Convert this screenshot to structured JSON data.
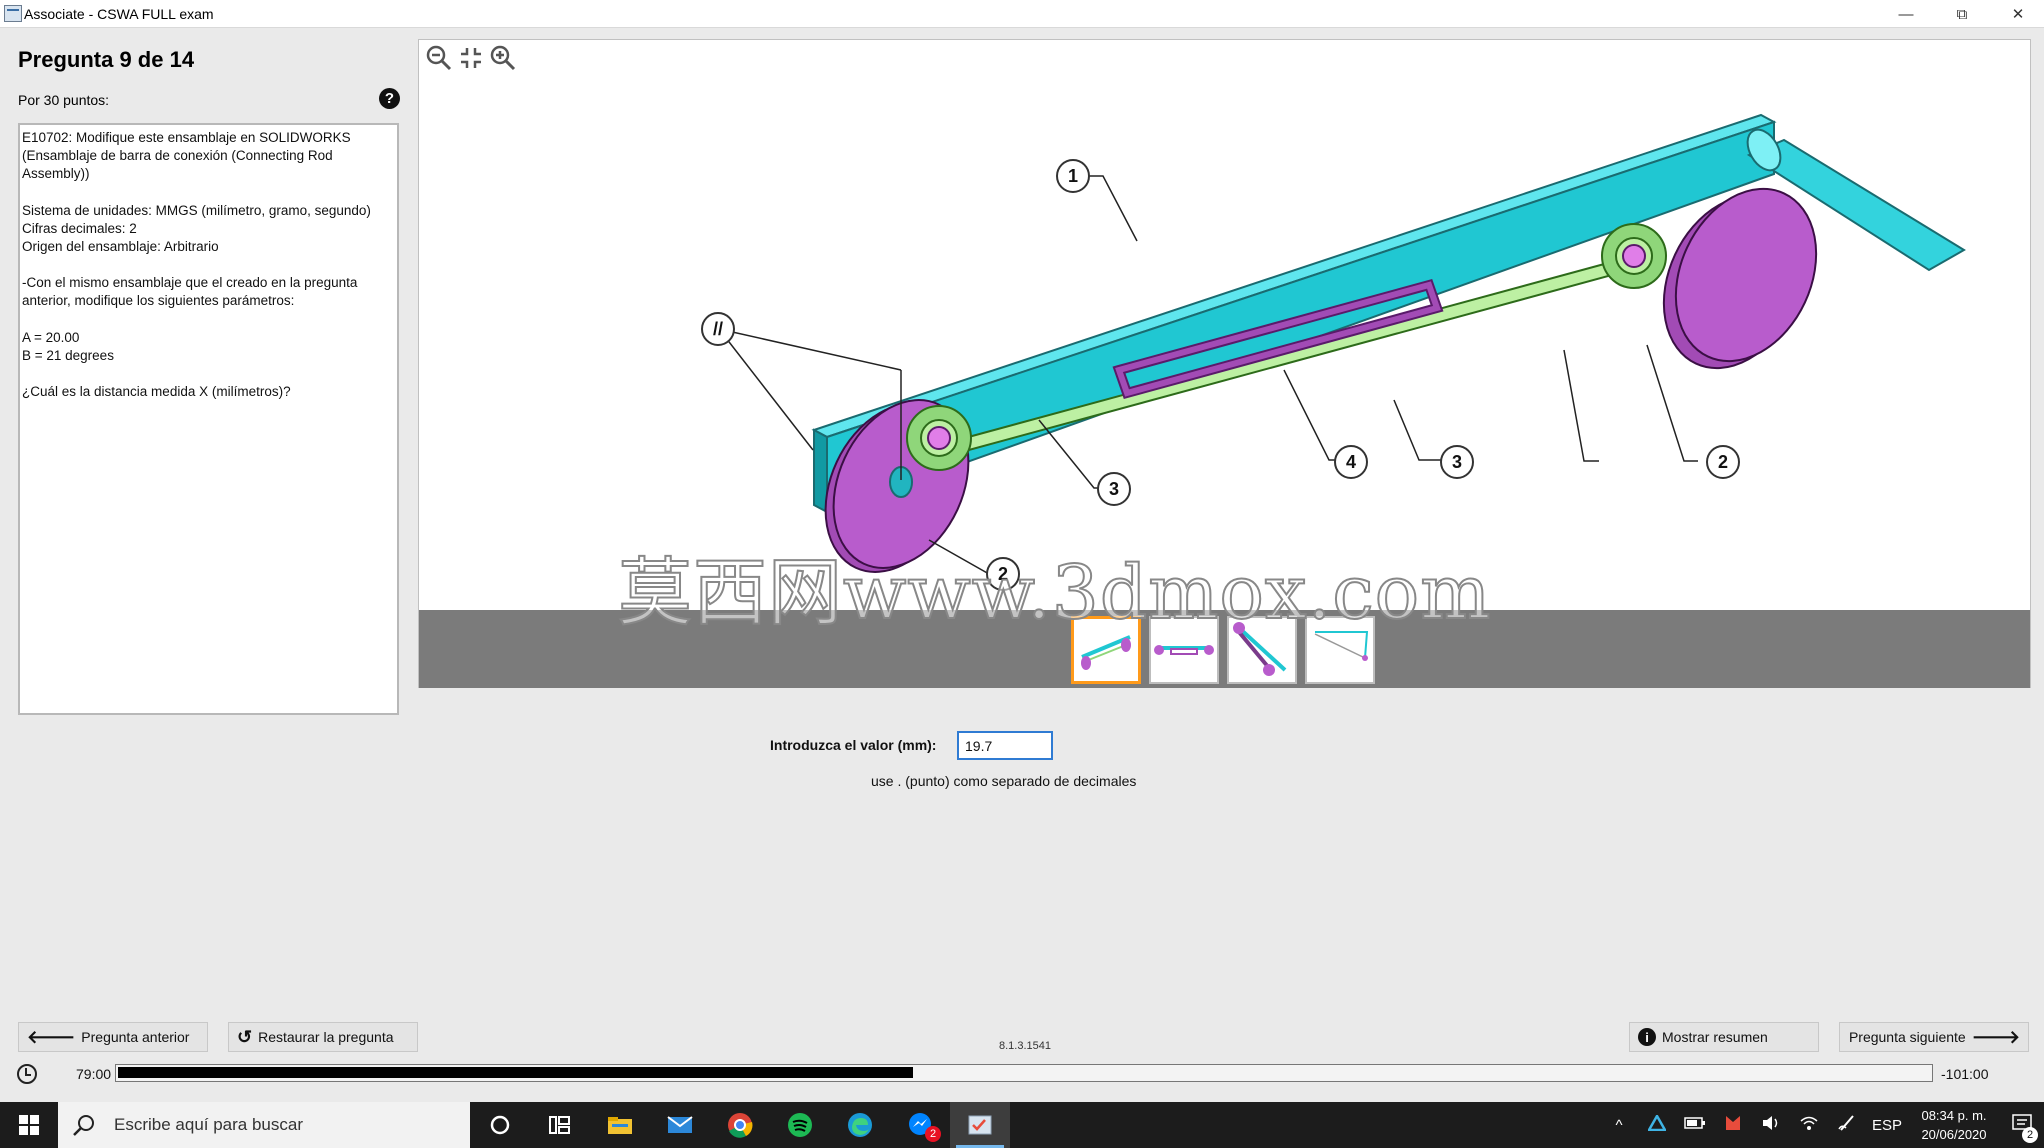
{
  "window": {
    "title": "Associate - CSWA FULL exam",
    "minimize": "—",
    "restore": "⧉",
    "close": "✕"
  },
  "question": {
    "header": "Pregunta 9 de 14",
    "points": "Por 30 puntos:",
    "help_icon": "?",
    "text_lines": [
      "E10702:  Modifique este ensamblaje en SOLIDWORKS",
      "(Ensamblaje de barra de conexión (Connecting Rod",
      "Assembly))",
      "",
      "Sistema de unidades: MMGS (milímetro, gramo, segundo)",
      "Cifras decimales: 2",
      "Origen del ensamblaje: Arbitrario",
      "",
      "-Con el mismo ensamblaje que el creado en la pregunta",
      "anterior, modifique los siguientes parámetros:",
      "",
      "A = 20.00",
      "B = 21 degrees",
      "",
      "¿Cuál es la distancia medida X (milímetros)?"
    ]
  },
  "viewer": {
    "tools": [
      "zoom-out-icon",
      "fit-icon",
      "zoom-in-icon"
    ],
    "callouts": {
      "c1": "1",
      "c2a": "2",
      "c2b": "2",
      "c3a": "3",
      "c3b": "3",
      "c4": "4",
      "parallel": "//"
    },
    "watermark": "莫西网www.3dmox.com",
    "thumbnails_count": 4,
    "active_thumbnail": 0
  },
  "answer": {
    "label": "Introduzca el valor (mm):",
    "value": "19.7",
    "hint": "use . (punto) como separado de decimales"
  },
  "buttons": {
    "prev": "Pregunta anterior",
    "restore": "Restaurar la pregunta",
    "summary": "Mostrar resumen",
    "next": "Pregunta siguiente"
  },
  "version": "8.1.3.1541",
  "timer": {
    "elapsed": "79:00",
    "remaining": "-101:00",
    "progress_fraction": 0.4386
  },
  "taskbar": {
    "search_placeholder": "Escribe aquí para buscar",
    "language": "ESP",
    "time": "08:34 p. m.",
    "date": "20/06/2020",
    "notifications": "2",
    "app_badge": "2"
  }
}
